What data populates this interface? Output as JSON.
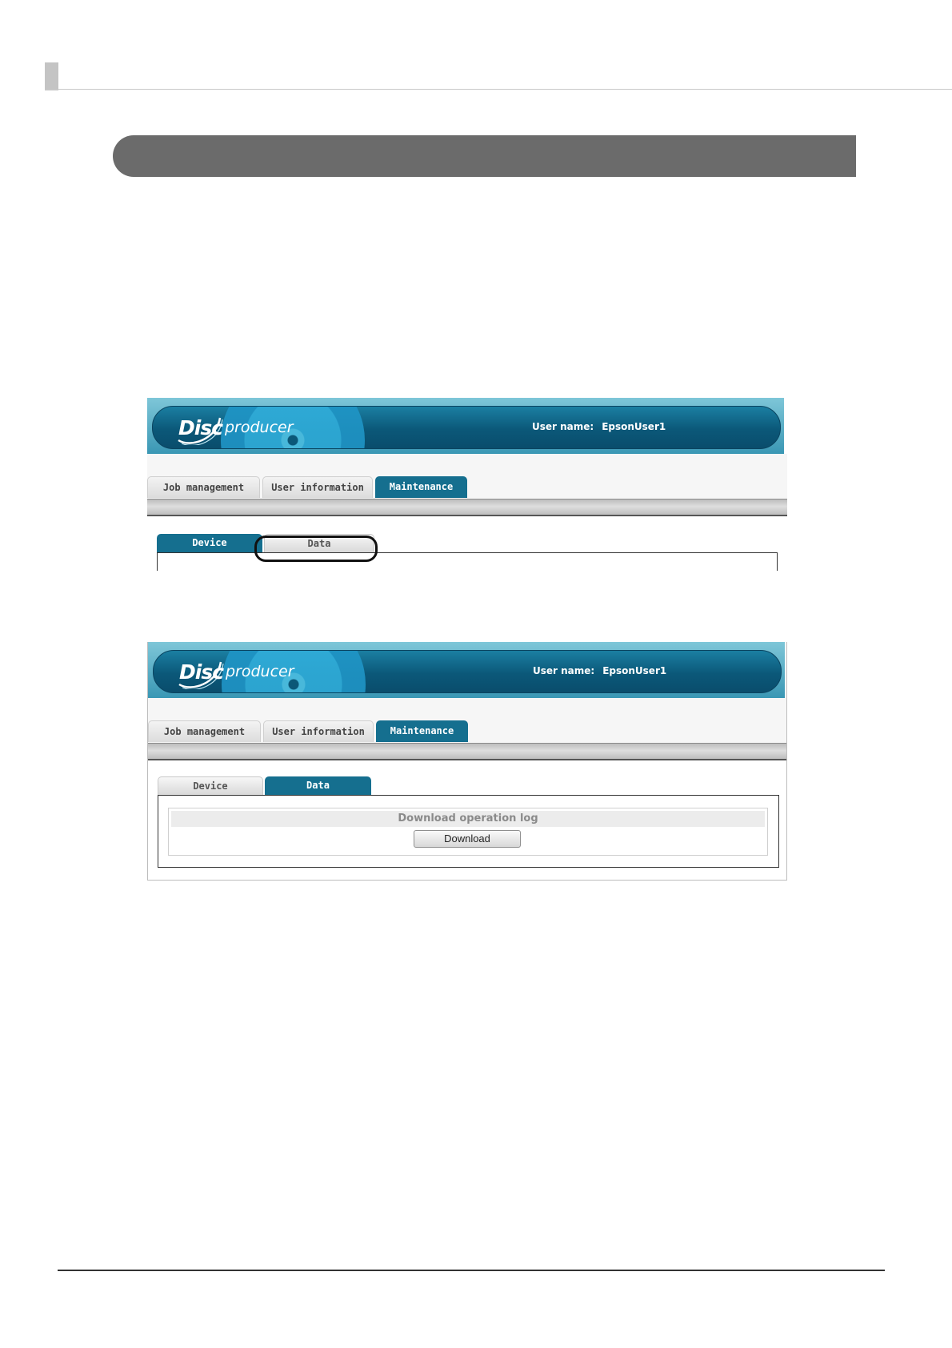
{
  "screen_before": {
    "app": {
      "logo_disc": "Disc",
      "logo_producer": "producer"
    },
    "header": {
      "user_label": "User name:",
      "user_value": "EpsonUser1"
    },
    "main_tabs": [
      {
        "label": "Job management",
        "active": false
      },
      {
        "label": "User information",
        "active": false
      },
      {
        "label": "Maintenance",
        "active": true
      }
    ],
    "sub_tabs": [
      {
        "label": "Device",
        "active": true
      },
      {
        "label": "Data",
        "active": false,
        "highlighted": true
      }
    ]
  },
  "screen_after": {
    "app": {
      "logo_disc": "Disc",
      "logo_producer": "producer"
    },
    "header": {
      "user_label": "User name:",
      "user_value": "EpsonUser1"
    },
    "main_tabs": [
      {
        "label": "Job management",
        "active": false
      },
      {
        "label": "User information",
        "active": false
      },
      {
        "label": "Maintenance",
        "active": true
      }
    ],
    "sub_tabs": [
      {
        "label": "Device",
        "active": false
      },
      {
        "label": "Data",
        "active": true
      }
    ],
    "operation_log": {
      "title": "Download operation log",
      "download_label": "Download"
    }
  },
  "colors": {
    "accent": "#156f8f",
    "banner": "#0b5879",
    "section_bar": "#6b6b6b",
    "highlight_ring": "#111111"
  }
}
